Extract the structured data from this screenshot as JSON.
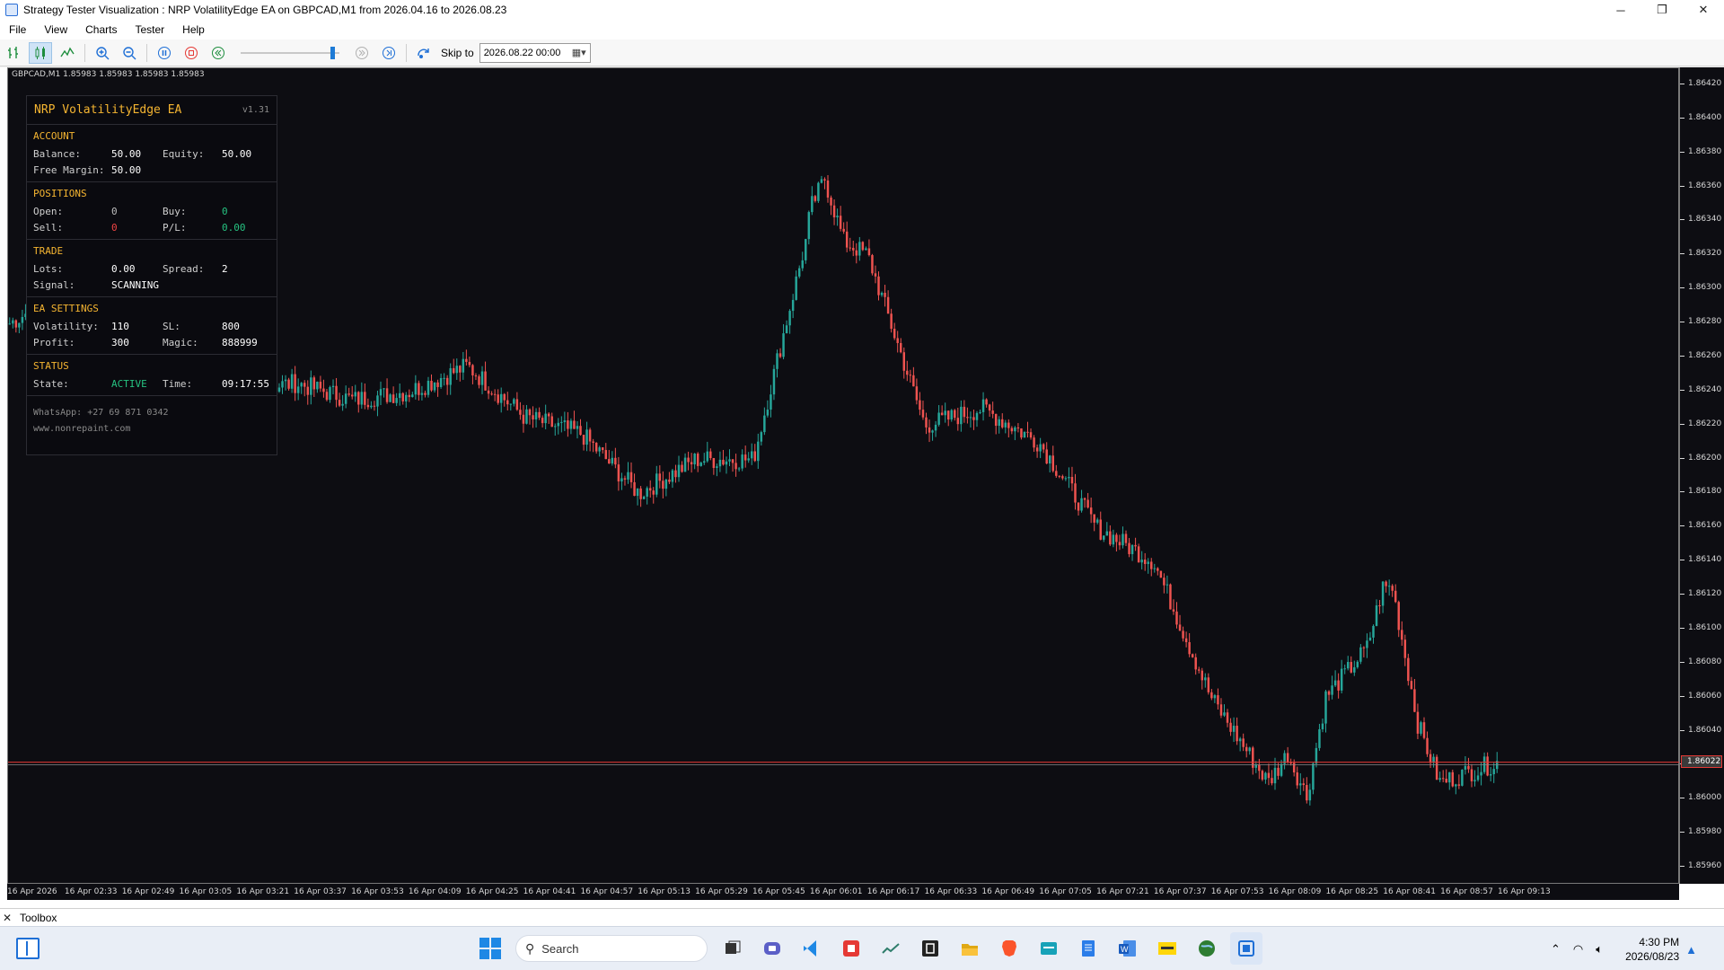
{
  "window": {
    "title": "Strategy Tester Visualization : NRP VolatilityEdge EA on GBPCAD,M1 from 2026.04.16 to 2026.08.23",
    "minimize_glyph": "─",
    "restore_glyph": "❐",
    "close_glyph": "✕"
  },
  "menu": [
    "File",
    "View",
    "Charts",
    "Tester",
    "Help"
  ],
  "toolbar": {
    "skip_label": "Skip to",
    "skip_date": "2026.08.22 00:00"
  },
  "chart": {
    "symbol_line": "GBPCAD,M1  1.85983 1.85983 1.85983 1.85983",
    "current_price_label": "1.86022",
    "colors": {
      "bull": "#26a69a",
      "bear": "#ef5350",
      "background": "#0d0d12",
      "price_line": "#e53935"
    }
  },
  "chart_data": {
    "type": "candlestick",
    "symbol": "GBPCAD",
    "timeframe": "M1",
    "y_ticks": [
      "1.86420",
      "1.86400",
      "1.86380",
      "1.86360",
      "1.86340",
      "1.86320",
      "1.86300",
      "1.86280",
      "1.86260",
      "1.86240",
      "1.86220",
      "1.86200",
      "1.86180",
      "1.86160",
      "1.86140",
      "1.86120",
      "1.86100",
      "1.86080",
      "1.86060",
      "1.86040",
      "1.86020",
      "1.86000",
      "1.85980",
      "1.85960"
    ],
    "ylim": [
      1.8595,
      1.8643
    ],
    "x_ticks": [
      "16 Apr 2026",
      "16 Apr 02:33",
      "16 Apr 02:49",
      "16 Apr 03:05",
      "16 Apr 03:21",
      "16 Apr 03:37",
      "16 Apr 03:53",
      "16 Apr 04:09",
      "16 Apr 04:25",
      "16 Apr 04:41",
      "16 Apr 04:57",
      "16 Apr 05:13",
      "16 Apr 05:29",
      "16 Apr 05:45",
      "16 Apr 06:01",
      "16 Apr 06:17",
      "16 Apr 06:33",
      "16 Apr 06:49",
      "16 Apr 07:05",
      "16 Apr 07:21",
      "16 Apr 07:37",
      "16 Apr 07:53",
      "16 Apr 08:09",
      "16 Apr 08:25",
      "16 Apr 08:41",
      "16 Apr 08:57",
      "16 Apr 09:13"
    ],
    "close_path": [
      [
        "16 Apr 2026",
        1.8628
      ],
      [
        "16 Apr 02:33",
        1.863
      ],
      [
        "16 Apr 02:49",
        1.8627
      ],
      [
        "16 Apr 03:05",
        1.8625
      ],
      [
        "16 Apr 03:21",
        1.8624
      ],
      [
        "16 Apr 03:37",
        1.86245
      ],
      [
        "16 Apr 03:53",
        1.86235
      ],
      [
        "16 Apr 04:09",
        1.8624
      ],
      [
        "16 Apr 04:25",
        1.86255
      ],
      [
        "16 Apr 04:41",
        1.86225
      ],
      [
        "16 Apr 04:57",
        1.86215
      ],
      [
        "16 Apr 05:13",
        1.8618
      ],
      [
        "16 Apr 05:29",
        1.862
      ],
      [
        "16 Apr 05:45",
        1.862
      ],
      [
        "16 Apr 06:01",
        1.8634
      ],
      [
        "16 Apr 06:17",
        1.8632
      ],
      [
        "16 Apr 06:33",
        1.8622
      ],
      [
        "16 Apr 06:49",
        1.8623
      ],
      [
        "16 Apr 07:05",
        1.8621
      ],
      [
        "16 Apr 07:21",
        1.8616
      ],
      [
        "16 Apr 07:37",
        1.8614
      ],
      [
        "16 Apr 07:53",
        1.8606
      ],
      [
        "16 Apr 08:09",
        1.8601
      ],
      [
        "16 Apr 08:25",
        1.8606
      ],
      [
        "16 Apr 08:41",
        1.861
      ],
      [
        "16 Apr 08:57",
        1.8601
      ],
      [
        "16 Apr 09:13",
        1.86022
      ]
    ],
    "high_point": 1.86362,
    "low_point": 1.85954,
    "last_price": 1.86022
  },
  "panel": {
    "title": "NRP VolatilityEdge EA",
    "version": "v1.31",
    "account": {
      "heading": "ACCOUNT",
      "balance_label": "Balance:",
      "balance": "50.00",
      "equity_label": "Equity:",
      "equity": "50.00",
      "free_margin_label": "Free Margin:",
      "free_margin": "50.00"
    },
    "positions": {
      "heading": "POSITIONS",
      "open_label": "Open:",
      "open": "0",
      "buy_label": "Buy:",
      "buy": "0",
      "sell_label": "Sell:",
      "sell": "0",
      "pl_label": "P/L:",
      "pl": "0.00"
    },
    "trade": {
      "heading": "TRADE",
      "lots_label": "Lots:",
      "lots": "0.00",
      "spread_label": "Spread:",
      "spread": "2",
      "signal_label": "Signal:",
      "signal": "SCANNING"
    },
    "settings": {
      "heading": "EA SETTINGS",
      "volatility_label": "Volatility:",
      "volatility": "110",
      "sl_label": "SL:",
      "sl": "800",
      "profit_label": "Profit:",
      "profit": "300",
      "magic_label": "Magic:",
      "magic": "888999"
    },
    "status": {
      "heading": "STATUS",
      "state_label": "State:",
      "state": "ACTIVE",
      "time_label": "Time:",
      "time": "09:17:55"
    },
    "footer": {
      "whatsapp": "WhatsApp: +27 69 871 0342",
      "website": "www.nonrepaint.com"
    }
  },
  "toolbox": {
    "close_glyph": "✕",
    "label": "Toolbox"
  },
  "taskbar": {
    "search_placeholder": "Search",
    "time": "4:30 PM",
    "date": "2026/08/23"
  }
}
